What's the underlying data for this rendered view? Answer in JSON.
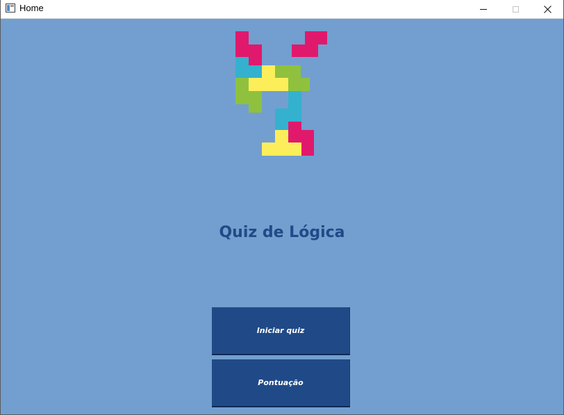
{
  "window": {
    "title": "Home",
    "icon": "app-window-icon",
    "controls": [
      "minimize-icon",
      "maximize-icon",
      "close-icon"
    ]
  },
  "logo": {
    "icon": "tetromino-stack-logo",
    "colors": {
      "magenta": "#e0196d",
      "cyan": "#34b1cf",
      "yellow": "#fcee5b",
      "green": "#8fc13e"
    }
  },
  "main": {
    "title": "Quiz de Lógica",
    "buttons": {
      "start_label": "Iniciar quiz",
      "score_label": "Pontuação"
    }
  },
  "colors": {
    "background": "#729fcf",
    "accent": "#204a87",
    "button_text": "#ffffff"
  }
}
